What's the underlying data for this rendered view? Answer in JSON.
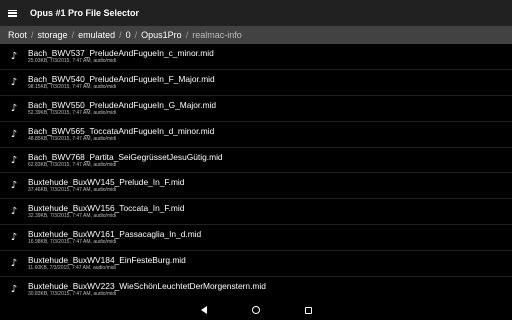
{
  "app": {
    "title": "Opus #1 Pro File Selector",
    "menu_icon": "hamburger-menu-icon"
  },
  "breadcrumb": [
    "Root",
    "storage",
    "emulated",
    "0",
    "Opus1Pro",
    "realmac-info"
  ],
  "files": [
    {
      "name": "Bach_BWV537_PreludeAndFugueIn_c_minor.mid",
      "meta": "25.03KB, 7/3/2015, 7:47 AM, audio/midi"
    },
    {
      "name": "Bach_BWV540_PreludeAndFugueIn_F_Major.mid",
      "meta": "98.15KB, 7/3/2015, 7:47 AM, audio/midi"
    },
    {
      "name": "Bach_BWV550_PreludeAndFugueIn_G_Major.mid",
      "meta": "52.39KB, 7/3/2015, 7:47 AM, audio/midi"
    },
    {
      "name": "Bach_BWV565_ToccataAndFugueIn_d_minor.mid",
      "meta": "48.85KB, 7/3/2015, 7:47 AM, audio/midi"
    },
    {
      "name": "Bach_BWV768_Partita_SeiGegrüssetJesuGütig.mid",
      "meta": "62.83KB, 7/3/2015, 7:47 AM, audio/midi"
    },
    {
      "name": "Buxtehude_BuxWV145_Prelude_In_F.mid",
      "meta": "37.46KB, 7/3/2015, 7:47 AM, audio/midi"
    },
    {
      "name": "Buxtehude_BuxWV156_Toccata_In_F.mid",
      "meta": "32.39KB, 7/3/2015, 7:47 AM, audio/midi"
    },
    {
      "name": "Buxtehude_BuxWV161_Passacaglia_In_d.mid",
      "meta": "16.98KB, 7/3/2015, 7:47 AM, audio/midi"
    },
    {
      "name": "Buxtehude_BuxWV184_EinFesteBurg.mid",
      "meta": "11.60KB, 7/3/2015, 7:47 AM, audio/midi"
    },
    {
      "name": "Buxtehude_BuxWV223_WieSchönLeuchtetDerMorgenstern.mid",
      "meta": "30.83KB, 7/3/2015, 7:47 AM, audio/midi"
    }
  ],
  "file_icon": "music-note-icon",
  "file_icon_glyph": "♪",
  "navbar": {
    "back_icon": "back-triangle-icon",
    "home_icon": "home-circle-icon",
    "recents_icon": "recents-square-icon"
  },
  "colors": {
    "appbar": "#212121",
    "breadcrumb_bar": "#424242",
    "background": "#000000",
    "text": "#ffffff",
    "meta_text": "#bdbdbd"
  }
}
